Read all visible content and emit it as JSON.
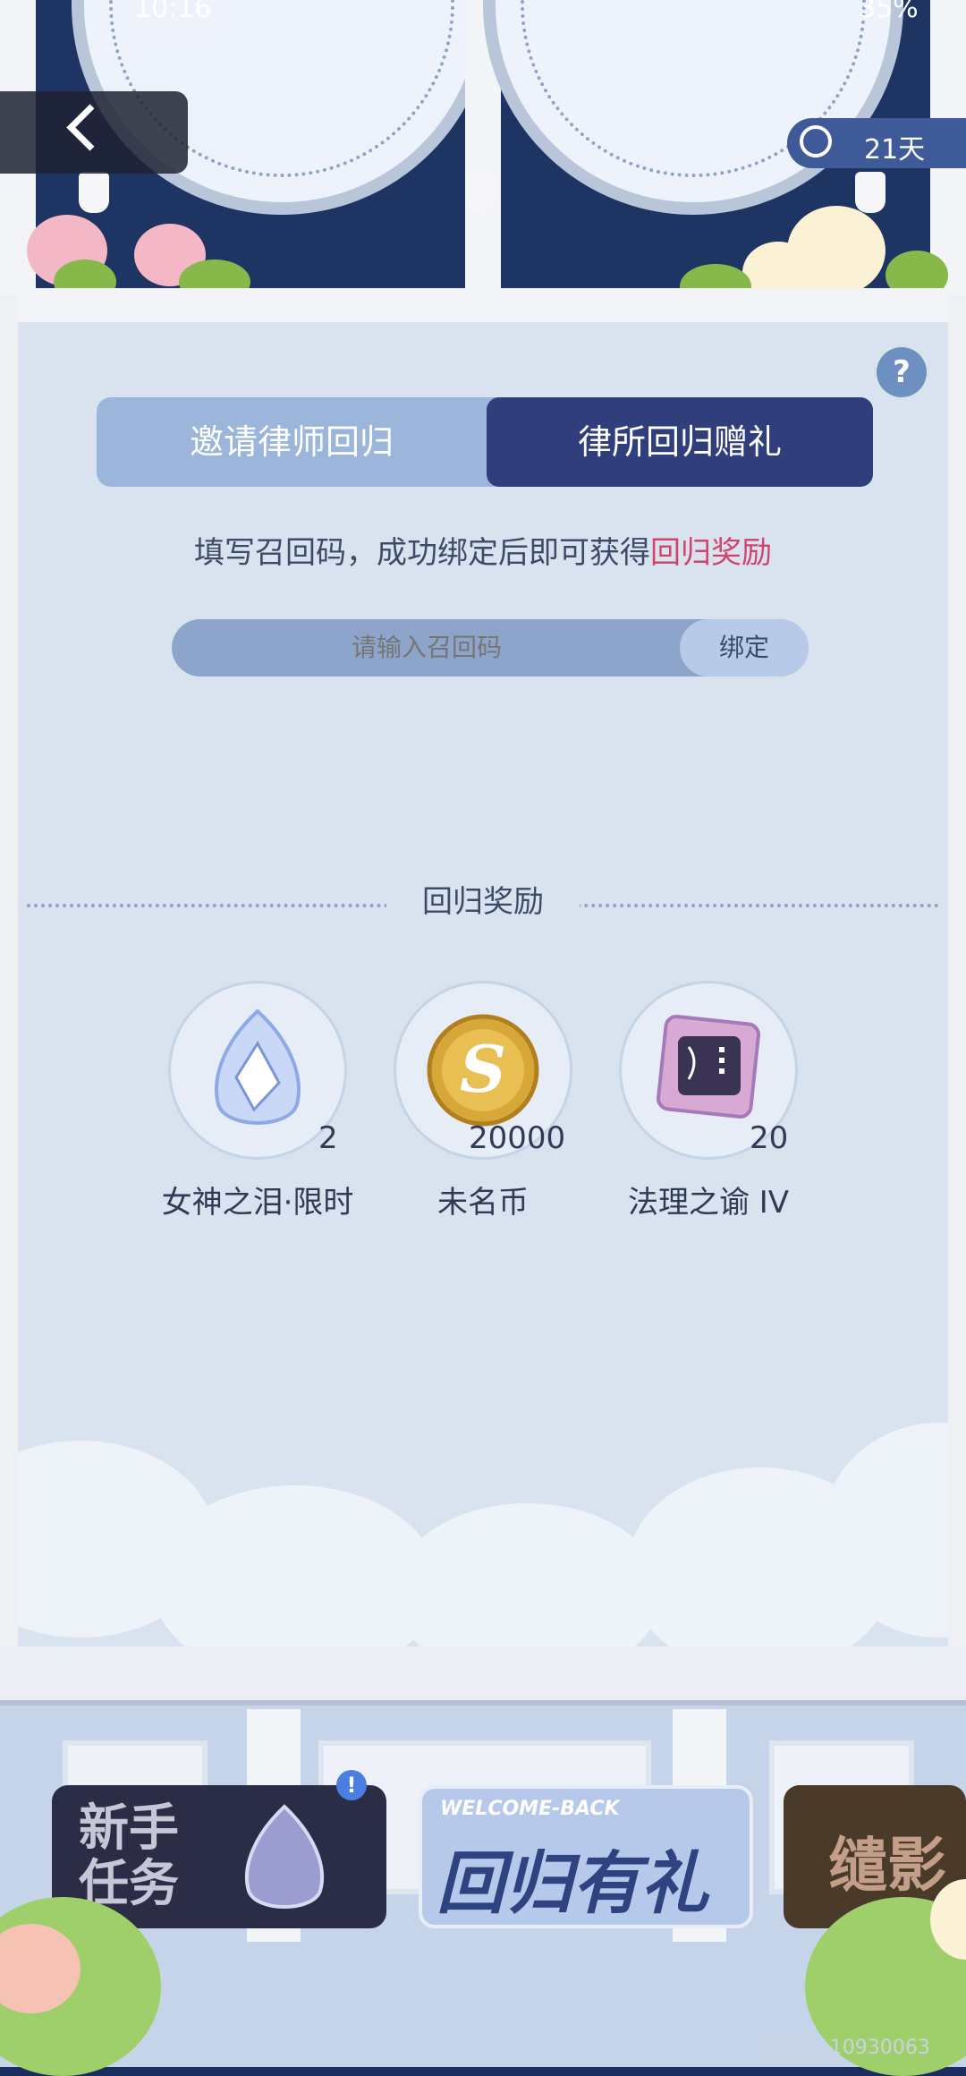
{
  "status_bar": {
    "time": "10:16",
    "battery": "35%"
  },
  "header": {
    "timer_label": "21天"
  },
  "tabs": [
    {
      "label": "邀请律师回归"
    },
    {
      "label": "律所回归赠礼"
    }
  ],
  "bind_section": {
    "description_prefix": "填写召回码，成功绑定后即可获得",
    "description_highlight": "回归奖励",
    "input_placeholder": "请输入召回码",
    "bind_button": "绑定"
  },
  "rewards_section": {
    "title": "回归奖励",
    "items": [
      {
        "name": "女神之泪·限时",
        "count": "2",
        "icon": "crystal-icon"
      },
      {
        "name": "未名币",
        "count": "20000",
        "icon": "coin-icon"
      },
      {
        "name": "法理之谕 IV",
        "count": "20",
        "icon": "chip-icon"
      }
    ]
  },
  "banners": [
    {
      "label": "新手\n任务"
    },
    {
      "label": "回归有礼",
      "sublabel": "WELCOME-BACK"
    },
    {
      "label": "缱影"
    }
  ],
  "footer": {
    "uid": "UID: 110930063"
  },
  "colors": {
    "accent_pink": "#d2456a",
    "tab_active": "#303f7c",
    "tab_inactive": "#9bb5db",
    "panel_bg": "#d9e3f0"
  }
}
